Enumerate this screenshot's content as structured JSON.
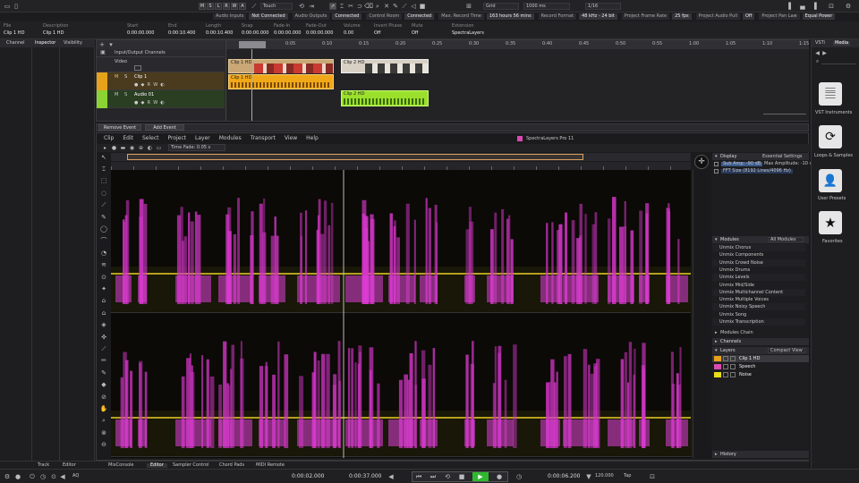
{
  "toolbar": {
    "m": "M",
    "s": "S",
    "l": "L",
    "r": "R",
    "w": "W",
    "a": "A",
    "mode": "Touch",
    "grid": "Grid",
    "grid_value": "1000 ms",
    "quantize": "1/16"
  },
  "status": [
    {
      "k": "Audio Inputs",
      "v": "Not Connected"
    },
    {
      "k": "Audio Outputs",
      "v": "Connected"
    },
    {
      "k": "Control Room",
      "v": "Connected"
    },
    {
      "k": "Max. Record Time",
      "v": "163 hours 56 mins"
    },
    {
      "k": "Record Format",
      "v": "48 kHz - 24 bit"
    },
    {
      "k": "Project Frame Rate",
      "v": "25 fps"
    },
    {
      "k": "Project Audio Pull",
      "v": "Off"
    },
    {
      "k": "Project Pan Law",
      "v": "Equal Power"
    }
  ],
  "infoline": {
    "headers": [
      "File",
      "Description",
      "Start",
      "End",
      "Length",
      "Snap",
      "Fade-In",
      "Fade-Out",
      "Volume",
      "Invert Phase",
      "Mute",
      "Extension"
    ],
    "values": [
      "Clip 1 HD",
      "Clip 1 HD",
      "0:00:00.000",
      "0:00:10.400",
      "0:00:10.400",
      "0:00:00.000",
      "0:00:00.000",
      "0:00:00.000",
      "0.00",
      "Off",
      "Off",
      "SpectraLayers"
    ]
  },
  "left": {
    "channel": "Channel",
    "inspector": "Inspector",
    "visibility": "Visibility",
    "track": "Track",
    "editor": "Editor"
  },
  "tracks": {
    "folder": "Input/Output Channels",
    "video": "Video",
    "clip1": "Clip 1",
    "audio01": "Audio 01",
    "clip_label": "Clip 1 HD",
    "clip_label2": "Clip 2 HD"
  },
  "ruler": {
    "marks": [
      "0:05",
      "0:10",
      "0:15",
      "0:20",
      "0:25",
      "0:30",
      "0:35",
      "0:40",
      "0:45",
      "0:50",
      "0:55",
      "1:00",
      "1:05",
      "1:10",
      "1:15"
    ]
  },
  "event": {
    "remove": "Remove Event",
    "add": "Add Event"
  },
  "sl": {
    "menus": [
      "Clip",
      "Edit",
      "Select",
      "Project",
      "Layer",
      "Modules",
      "Transport",
      "View",
      "Help"
    ],
    "title": "SpectraLayers Pro 11",
    "time_fade": "Time Fade: 0.05 s"
  },
  "display": {
    "title": "Display",
    "preset": "Essential Settings",
    "row1": "Sub Amp: -90 dB",
    "row1b": "Max Amplitude: -10 dB",
    "row2": "FFT Size (8192 Lines/4096 Hz)"
  },
  "modules": {
    "title": "Modules",
    "dropdown": "All Modules",
    "items": [
      "Unmix Chorus",
      "Unmix Components",
      "Unmix Crowd Noise",
      "Unmix Drums",
      "Unmix Levels",
      "Unmix Mid/Side",
      "Unmix Multichannel Content",
      "Unmix Multiple Voices",
      "Unmix Noisy Speech",
      "Unmix Song",
      "Unmix Transcription"
    ],
    "chain": "Modules Chain"
  },
  "channels": {
    "title": "Channels"
  },
  "layers": {
    "title": "Layers",
    "dropdown": "Compact View",
    "items": [
      "Clip 1 HD",
      "Speech",
      "Noise"
    ]
  },
  "history": {
    "title": "History"
  },
  "right": {
    "tab1": "VSTi",
    "tab2": "Media",
    "items": [
      "VST Instruments",
      "Loops & Samples",
      "User Presets",
      "Favorites"
    ]
  },
  "bottom": {
    "tabs": [
      "Track",
      "Editor",
      "MixConsole",
      "Editor",
      "Sampler Control",
      "Chord Pads",
      "MIDI Remote"
    ],
    "time1": "0:00:02.000",
    "time2": "0:00:37.000",
    "time3": "0:00:06.200",
    "tempo": "120.000",
    "tap": "Tap",
    "aq": "AQ"
  }
}
